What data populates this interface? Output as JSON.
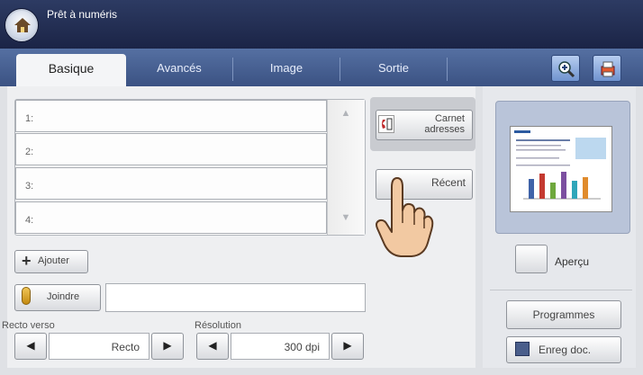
{
  "header": {
    "title": "Prêt à numéris"
  },
  "tabs": [
    {
      "label": "Basique",
      "active": true
    },
    {
      "label": "Avancés"
    },
    {
      "label": "Image"
    },
    {
      "label": "Sortie"
    }
  ],
  "toolbar_icons": [
    "zoom-in-icon",
    "job-status-icon"
  ],
  "destinations": [
    {
      "label": "1:"
    },
    {
      "label": "2:"
    },
    {
      "label": "3:"
    },
    {
      "label": "4:"
    }
  ],
  "buttons": {
    "carnet": "Carnet adresses",
    "recent": "Récent",
    "add": "Ajouter",
    "attach": "Joindre"
  },
  "attach_value": "",
  "duplex": {
    "label": "Recto verso",
    "value": "Recto"
  },
  "resolution": {
    "label": "Résolution",
    "value": "300 dpi"
  },
  "preview": {
    "label": "Aperçu"
  },
  "side_buttons": {
    "programs": "Programmes",
    "save": "Enreg doc."
  },
  "colors": {
    "accent": "#3b5283",
    "topbar": "#1b2446"
  }
}
